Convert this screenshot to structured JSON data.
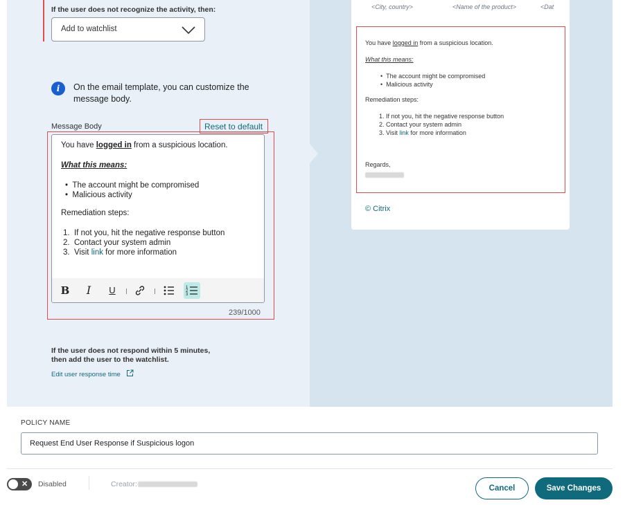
{
  "condition": {
    "label": "If the user does not recognize the activity, then:",
    "select_value": "Add to watchlist"
  },
  "info": {
    "text": "On the email template, you can customize the message body."
  },
  "message_body": {
    "label": "Message Body",
    "reset_label": "Reset to default",
    "line1_pre": "You have ",
    "line1_link": "logged in",
    "line1_post": " from a suspicious location.",
    "means_heading": "What this means:",
    "bullets": [
      "The account might be compromised",
      "Malicious activity"
    ],
    "remediation_heading": "Remediation steps:",
    "steps": [
      "If not you, hit the negative response button",
      "Contact your system admin"
    ],
    "step3_pre": "Visit ",
    "step3_link": "link",
    "step3_post": " for more information",
    "counter": "239/1000"
  },
  "toolbar": {
    "bold": "B",
    "italic": "I",
    "underline": "U"
  },
  "no_response": {
    "text": "If the user does not respond within 5 minutes, then add the user to the watchlist.",
    "edit_link": "Edit user response time"
  },
  "preview": {
    "placeholders": [
      "<City, country>",
      "<Name of the product>",
      "<Dat"
    ],
    "line1_pre": "You have ",
    "line1_link": "logged in",
    "line1_post": " from a suspicious location.",
    "means_heading": "What this means:",
    "bullets": [
      "The account might be compromised",
      "Malicious activity"
    ],
    "remediation_heading": "Remediation steps:",
    "steps": [
      "If not you, hit the negative response button",
      "Contact your system admin"
    ],
    "step3_pre": "Visit ",
    "step3_link": "link",
    "step3_post": " for more information",
    "regards": "Regards,",
    "copyright": "© Citrix"
  },
  "policy": {
    "label": "POLICY NAME",
    "value": "Request End User Response if Suspicious logon"
  },
  "footer": {
    "status_label": "Disabled",
    "creator_label": "Creator:",
    "cancel_label": "Cancel",
    "save_label": "Save Changes"
  },
  "colors": {
    "accent": "#0f6a7c",
    "highlight": "#e14b4b",
    "info": "#1a5fd0"
  },
  "icons": [
    "info-icon",
    "chevron-down-icon",
    "link-icon",
    "bullet-list-icon",
    "numbered-list-icon",
    "external-link-icon",
    "close-icon"
  ]
}
